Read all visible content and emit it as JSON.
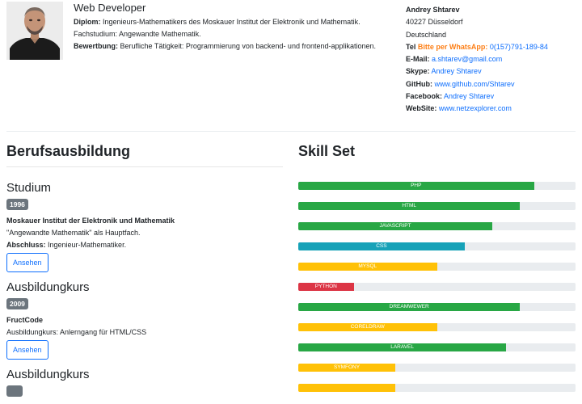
{
  "header": {
    "job_title": "Web Developer",
    "diplom_label": "Diplom:",
    "diplom_text": " Ingenieurs-Mathematikers des Moskauer Institut der Elektronik und Mathematik. Fachstudium: Angewandte Mathematik.",
    "bewerbung_label": "Bewertbung:",
    "bewerbung_text": " Berufliche Tätigkeit: Programmierung von backend- und frontend-applikationen."
  },
  "contact": {
    "name": "Andrey Shtarev",
    "city": "40227 Düsseldorf",
    "country": "Deutschland",
    "tel_label": "Tel",
    "whatsapp_label": "Bitte per WhatsApp:",
    "phone": "0(157)791-189-84",
    "email_label": "E-Mail:",
    "email": "a.shtarev@gmail.com",
    "skype_label": "Skype:",
    "skype": "Andrey Shtarev",
    "github_label": "GitHub:",
    "github": "www.github.com/Shtarev",
    "facebook_label": "Facebook:",
    "facebook": "Andrey Shtarev",
    "website_label": "WebSite:",
    "website": "www.netzexplorer.com"
  },
  "education": {
    "heading": "Berufsausbildung",
    "entries": [
      {
        "type": "Studium",
        "year": "1996",
        "institution": "Moskauer Institut der Elektronik und Mathematik",
        "detail": "\"Angewandte Mathematik\" als Hauptfach.",
        "extra_label": "Abschluss:",
        "extra_text": " Ingenieur-Mathematiker.",
        "button": "Ansehen"
      },
      {
        "type": "Ausbildungkurs",
        "year": "2009",
        "institution": "FructCode",
        "detail": "Ausbildungkurs: Anlerngang für HTML/CSS",
        "button": "Ansehen"
      },
      {
        "type": "Ausbildungkurs"
      }
    ]
  },
  "skills": {
    "heading": "Skill Set",
    "colors": {
      "green": "#28a745",
      "teal": "#17a2b8",
      "yellow": "#ffc107",
      "red": "#dc3545",
      "track": "#e9ecef"
    },
    "items": [
      {
        "name": "PHP",
        "level": 0.85,
        "color": "green"
      },
      {
        "name": "HTML",
        "level": 0.8,
        "color": "green"
      },
      {
        "name": "JAVASCRIPT",
        "level": 0.7,
        "color": "green"
      },
      {
        "name": "CSS",
        "level": 0.6,
        "color": "teal"
      },
      {
        "name": "MYSQL",
        "level": 0.5,
        "color": "yellow"
      },
      {
        "name": "PYTHON",
        "level": 0.2,
        "color": "red"
      },
      {
        "name": "DREAMWEWER",
        "level": 0.8,
        "color": "green"
      },
      {
        "name": "CORELDRAW",
        "level": 0.5,
        "color": "yellow"
      },
      {
        "name": "LARAVEL",
        "level": 0.75,
        "color": "green"
      },
      {
        "name": "SYMFONY",
        "level": 0.35,
        "color": "yellow"
      },
      {
        "name": "",
        "level": 0.35,
        "color": "yellow"
      }
    ]
  }
}
